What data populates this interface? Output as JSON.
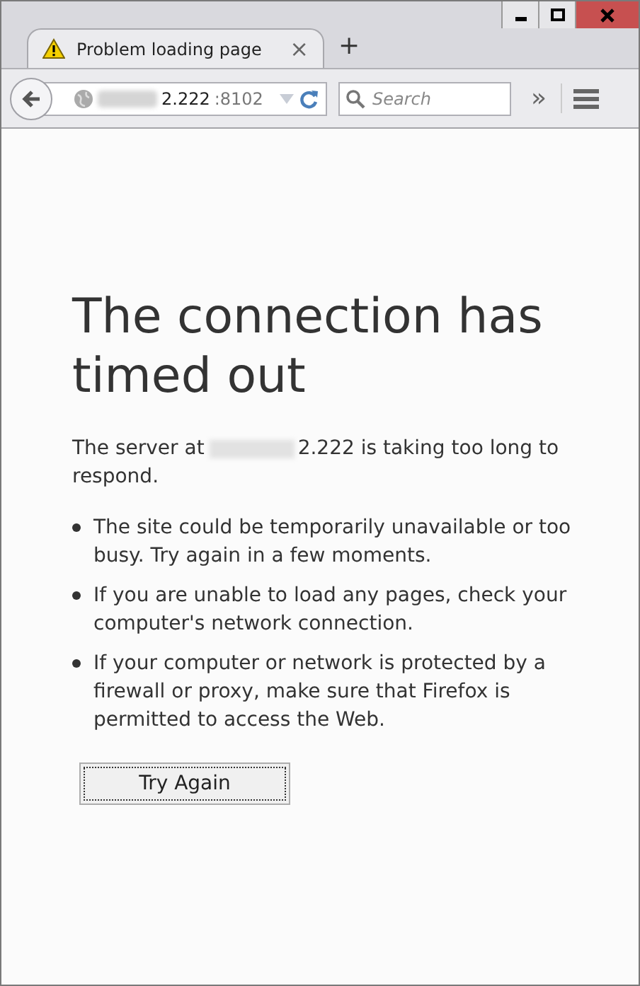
{
  "window": {
    "controls": [
      {
        "kind": "minimize"
      },
      {
        "kind": "maximize"
      },
      {
        "kind": "close"
      }
    ]
  },
  "tabs": [
    {
      "title": "Problem loading page",
      "selected": true,
      "close": "×"
    }
  ],
  "new_tab": "+",
  "nav": {
    "url_host": "2.222",
    "url_port": ":8102",
    "search_placeholder": "Search",
    "overflow": "»"
  },
  "error": {
    "title": "The connection has timed out",
    "server_prefix": "The server at",
    "server_suffix": "2.222 is taking too long to respond.",
    "bullets": [
      "The site could be temporarily unavailable or too busy. Try again in a few moments.",
      "If you are unable to load any pages, check your computer's network connection.",
      "If your computer or network is protected by a firewall or proxy, make sure that Firefox is permitted to access the Web."
    ],
    "button": "Try Again"
  }
}
